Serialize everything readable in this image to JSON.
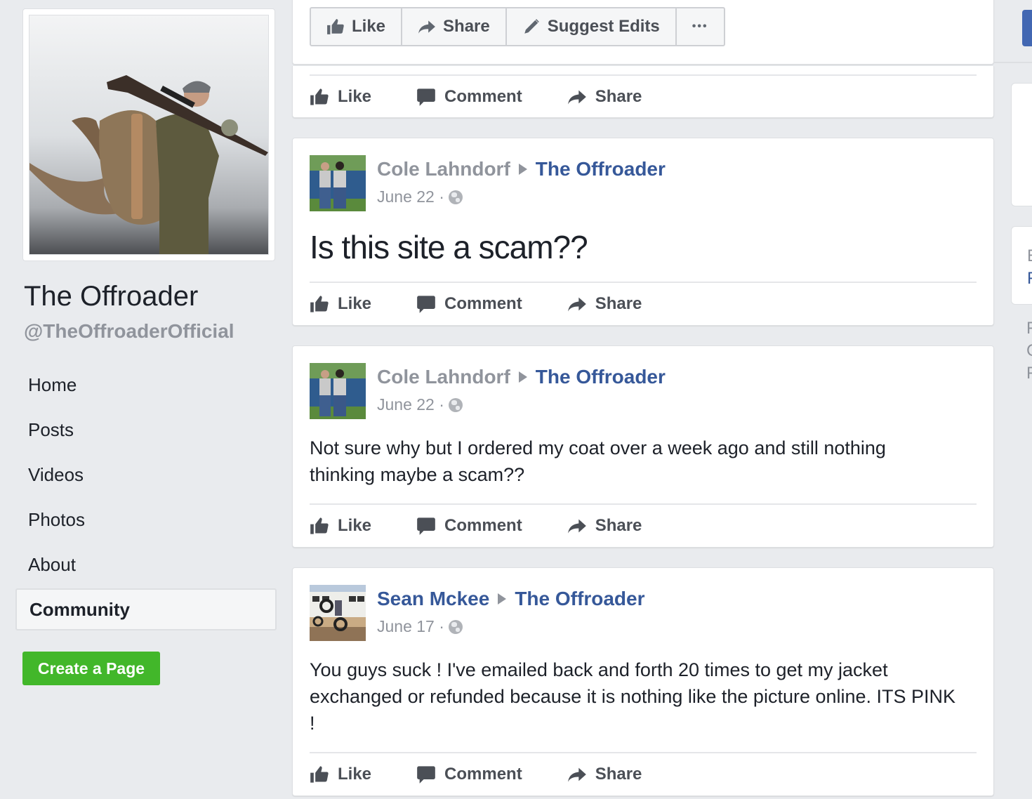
{
  "page": {
    "name": "The Offroader",
    "handle": "@TheOffroaderOfficial"
  },
  "nav": {
    "items": [
      {
        "label": "Home"
      },
      {
        "label": "Posts"
      },
      {
        "label": "Videos"
      },
      {
        "label": "Photos"
      },
      {
        "label": "About"
      },
      {
        "label": "Community",
        "active": true
      }
    ],
    "create_page_label": "Create a Page"
  },
  "page_actions": {
    "like": "Like",
    "share": "Share",
    "suggest_edits": "Suggest Edits",
    "more": "•••"
  },
  "post_actions": {
    "like": "Like",
    "comment": "Comment",
    "share": "Share"
  },
  "posts": [
    {
      "author": "Cole Lahndorf",
      "target": "The Offroader",
      "date": "June 22 ·",
      "text": "Is this site a scam??"
    },
    {
      "author": "Cole Lahndorf",
      "target": "The Offroader",
      "date": "June 22 ·",
      "text": "Not sure why but I ordered my coat over a week ago and still nothing thinking maybe a scam??"
    },
    {
      "author": "Sean Mckee",
      "target": "The Offroader",
      "date": "June 17 ·",
      "text": "You guys suck ! I've emailed back and forth 20 times to get my jacket exchanged or refunded because it is nothing like the picture online. ITS PINK !"
    }
  ],
  "right_column": {
    "card_lines": [
      "E",
      "F"
    ],
    "text_lines": [
      "F",
      "C",
      "F"
    ]
  },
  "colors": {
    "link_blue": "#365899",
    "create_green": "#42b72a",
    "background": "#e9ebee"
  }
}
